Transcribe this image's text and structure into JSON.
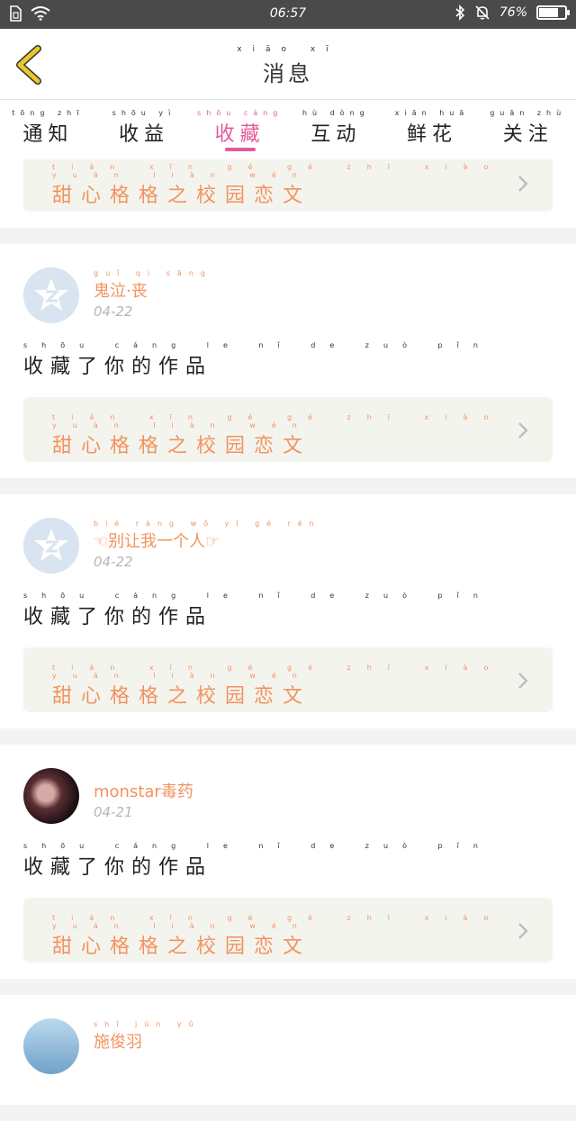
{
  "status_bar": {
    "time": "06:57",
    "battery": "76%",
    "battery_level": 0.76,
    "left_icons": [
      "sim-icon",
      "wifi-icon"
    ],
    "right_icons": [
      "bluetooth-icon",
      "mute-bell-icon",
      "battery-icon"
    ]
  },
  "header": {
    "title_pinyin": "xiāo xī",
    "title": "消息",
    "back_icon": "chevron-left-icon",
    "accent": "#e8c82a"
  },
  "tabs": [
    {
      "pinyin": "tōng zhī",
      "label": "通知",
      "active": false
    },
    {
      "pinyin": "shōu yì",
      "label": "收益",
      "active": false
    },
    {
      "pinyin": "shōu cáng",
      "label": "收藏",
      "active": true
    },
    {
      "pinyin": "hù dòng",
      "label": "互动",
      "active": false
    },
    {
      "pinyin": "xiān huā",
      "label": "鲜花",
      "active": false
    },
    {
      "pinyin": "guān zhù",
      "label": "关注",
      "active": false
    }
  ],
  "colors": {
    "active_tab": "#e35b9a",
    "username": "#f2935e",
    "work_title": "#f2935e",
    "date": "#b6b6b6"
  },
  "top_card": {
    "work_pinyin": "tián xīn gé gé zhī xiào yuán liàn wén",
    "work_title": "甜心格格之校园恋文"
  },
  "messages": [
    {
      "username_pinyin": "guǐ qì sāng",
      "username": "鬼泣·丧",
      "date": "04-22",
      "action_pinyin": "shōu cáng le nǐ de zuò pǐn",
      "action": "收藏了你的作品",
      "work_pinyin": "tián xīn gé gé zhī xiào yuán liàn wén",
      "work_title": "甜心格格之校园恋文"
    },
    {
      "username_pinyin": "bié ràng wǒ yī gè rén",
      "username": "☜别让我一个人☞",
      "date": "04-22",
      "action_pinyin": "shōu cáng le nǐ de zuò pǐn",
      "action": "收藏了你的作品",
      "work_pinyin": "tián xīn gé gé zhī xiào yuán liàn wén",
      "work_title": "甜心格格之校园恋文"
    },
    {
      "username_pinyin": "",
      "username": "monstar毒药",
      "date": "04-21",
      "action_pinyin": "shōu cáng le nǐ de zuò pǐn",
      "action": "收藏了你的作品",
      "work_pinyin": "tián xīn gé gé zhī xiào yuán liàn wén",
      "work_title": "甜心格格之校园恋文"
    },
    {
      "username_pinyin": "shī jùn yǔ",
      "username": "施俊羽",
      "date": "",
      "action_pinyin": "",
      "action": "",
      "work_pinyin": "",
      "work_title": ""
    }
  ]
}
